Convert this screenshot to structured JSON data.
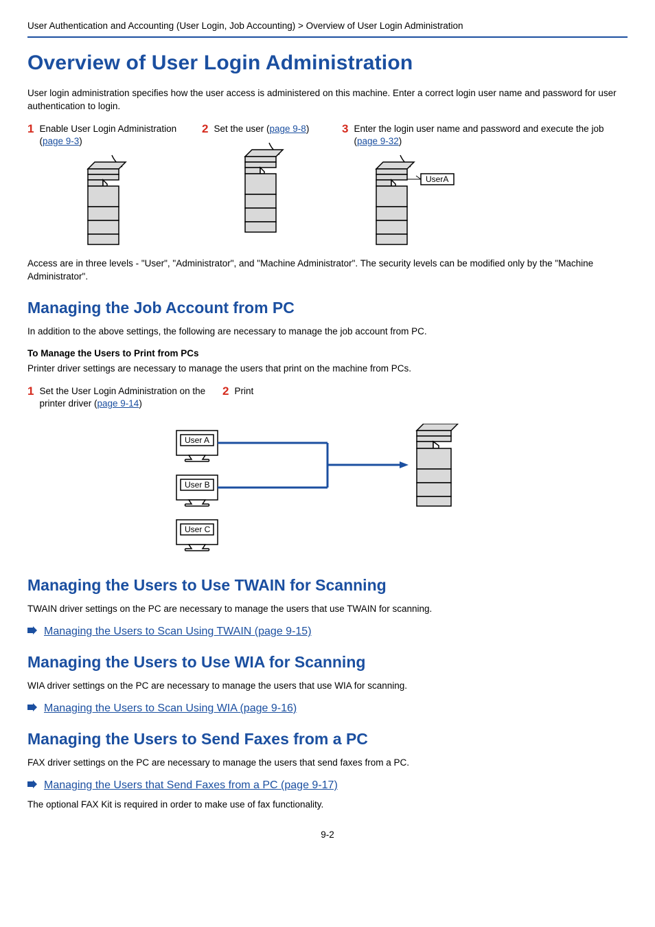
{
  "breadcrumb": "User Authentication and Accounting (User Login, Job Accounting) > Overview of User Login Administration",
  "title": "Overview of User Login Administration",
  "intro": "User login administration specifies how the user access is administered on this machine. Enter a correct login user name and password for user authentication to login.",
  "steps_top": {
    "s1": {
      "num": "1",
      "text_a": "Enable User Login Administration (",
      "link": "page 9-3",
      "text_b": ")"
    },
    "s2": {
      "num": "2",
      "text_a": "Set the user (",
      "link": "page 9-8",
      "text_b": ")"
    },
    "s3": {
      "num": "3",
      "text_a": "Enter the login user name and password and execute the job (",
      "link": "page 9-32",
      "text_b": ")"
    },
    "userA_label": "UserA"
  },
  "access_levels": "Access are in three levels - \"User\", \"Administrator\", and \"Machine Administrator\". The security levels can be modified only by the \"Machine Administrator\".",
  "pc_section": {
    "heading": "Managing the Job Account from PC",
    "intro": "In addition to the above settings, the following are necessary to manage the job account from PC.",
    "sub_bold": "To Manage the Users to Print from PCs",
    "sub_para": "Printer driver settings are necessary to manage the users that print on the machine from PCs.",
    "s1": {
      "num": "1",
      "text_a": "Set the User Login Administration on the printer driver (",
      "link": "page 9-14",
      "text_b": ")"
    },
    "s2": {
      "num": "2",
      "text": "Print"
    },
    "diagram": {
      "userA": "User A",
      "userB": "User B",
      "userC": "User C"
    }
  },
  "twain_section": {
    "heading": "Managing the Users to Use TWAIN for Scanning",
    "para": "TWAIN driver settings on the PC are necessary to manage the users that use TWAIN for scanning.",
    "link": "Managing the Users to Scan Using TWAIN (page 9-15)"
  },
  "wia_section": {
    "heading": "Managing the Users to Use WIA for Scanning",
    "para": "WIA driver settings on the PC are necessary to manage the users that use WIA for scanning.",
    "link": "Managing the Users to Scan Using WIA (page 9-16)"
  },
  "fax_section": {
    "heading": "Managing the Users to Send Faxes from a PC",
    "para": "FAX driver settings on the PC are necessary to manage the users that send faxes from a PC.",
    "link": "Managing the Users that Send Faxes from a PC (page 9-17)",
    "note": "The optional FAX Kit is required in order to make use of fax functionality."
  },
  "page_num": "9-2"
}
